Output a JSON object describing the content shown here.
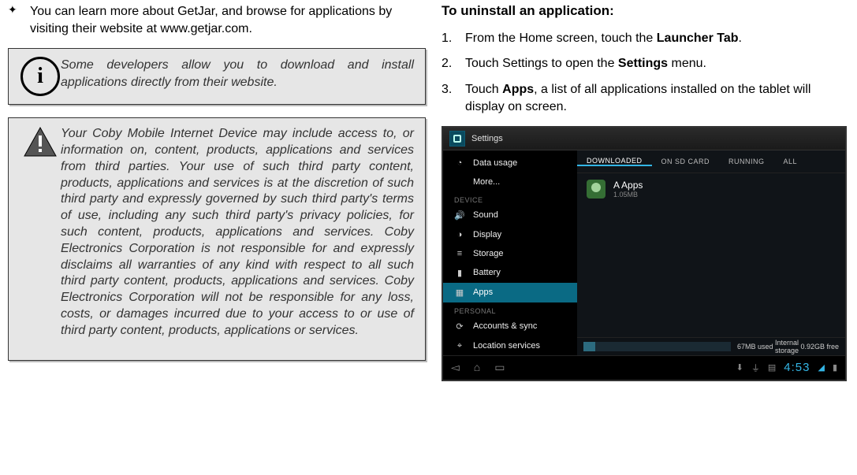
{
  "left": {
    "bullet": "You can learn more about GetJar, and browse for applications by visiting their website at www.getjar.com.",
    "info_glyph": "i",
    "info": "Some developers allow you to download and install applications directly from their website.",
    "warn": "Your Coby Mobile Internet Device may include access to, or information on, content, products, applications and services from third parties. Your use of such third party content, products, applications and services is at the discretion of such third party and expressly governed by such third party's terms of use, including any such third party's privacy policies, for such content, products, applications and services. Coby Electronics Corporation is not responsible for and expressly disclaims all warranties of any kind with respect to all such third party content, products, applications and services. Coby Electronics Corporation will not be responsible for any loss, costs, or damages incurred due to your access to or use of third party content, products, applications or services."
  },
  "right": {
    "heading": "To uninstall an application:",
    "step1_num": "1.",
    "step1_a": "From the Home screen, touch the ",
    "step1_b": "Launcher Tab",
    "step1_c": ".",
    "step2_num": "2.",
    "step2_a": "Touch Settings to open the ",
    "step2_b": "Settings",
    "step2_c": " menu.",
    "step3_num": "3.",
    "step3_a": "Touch ",
    "step3_b": "Apps",
    "step3_c": ", a list of all applications installed on the tablet will display on screen."
  },
  "android": {
    "title": "Settings",
    "side": {
      "data_usage": "Data usage",
      "more": "More...",
      "cat_device": "DEVICE",
      "sound": "Sound",
      "display": "Display",
      "storage": "Storage",
      "battery": "Battery",
      "apps": "Apps",
      "cat_personal": "PERSONAL",
      "accounts": "Accounts & sync",
      "location": "Location services"
    },
    "tabs": {
      "downloaded": "DOWNLOADED",
      "sdcard": "ON SD CARD",
      "running": "RUNNING",
      "all": "ALL"
    },
    "app": {
      "name": "A Apps",
      "size": "1.05MB"
    },
    "storage": {
      "used": "67MB used",
      "label": "Internal storage",
      "free": "0.92GB free"
    },
    "clock": "4:53"
  }
}
